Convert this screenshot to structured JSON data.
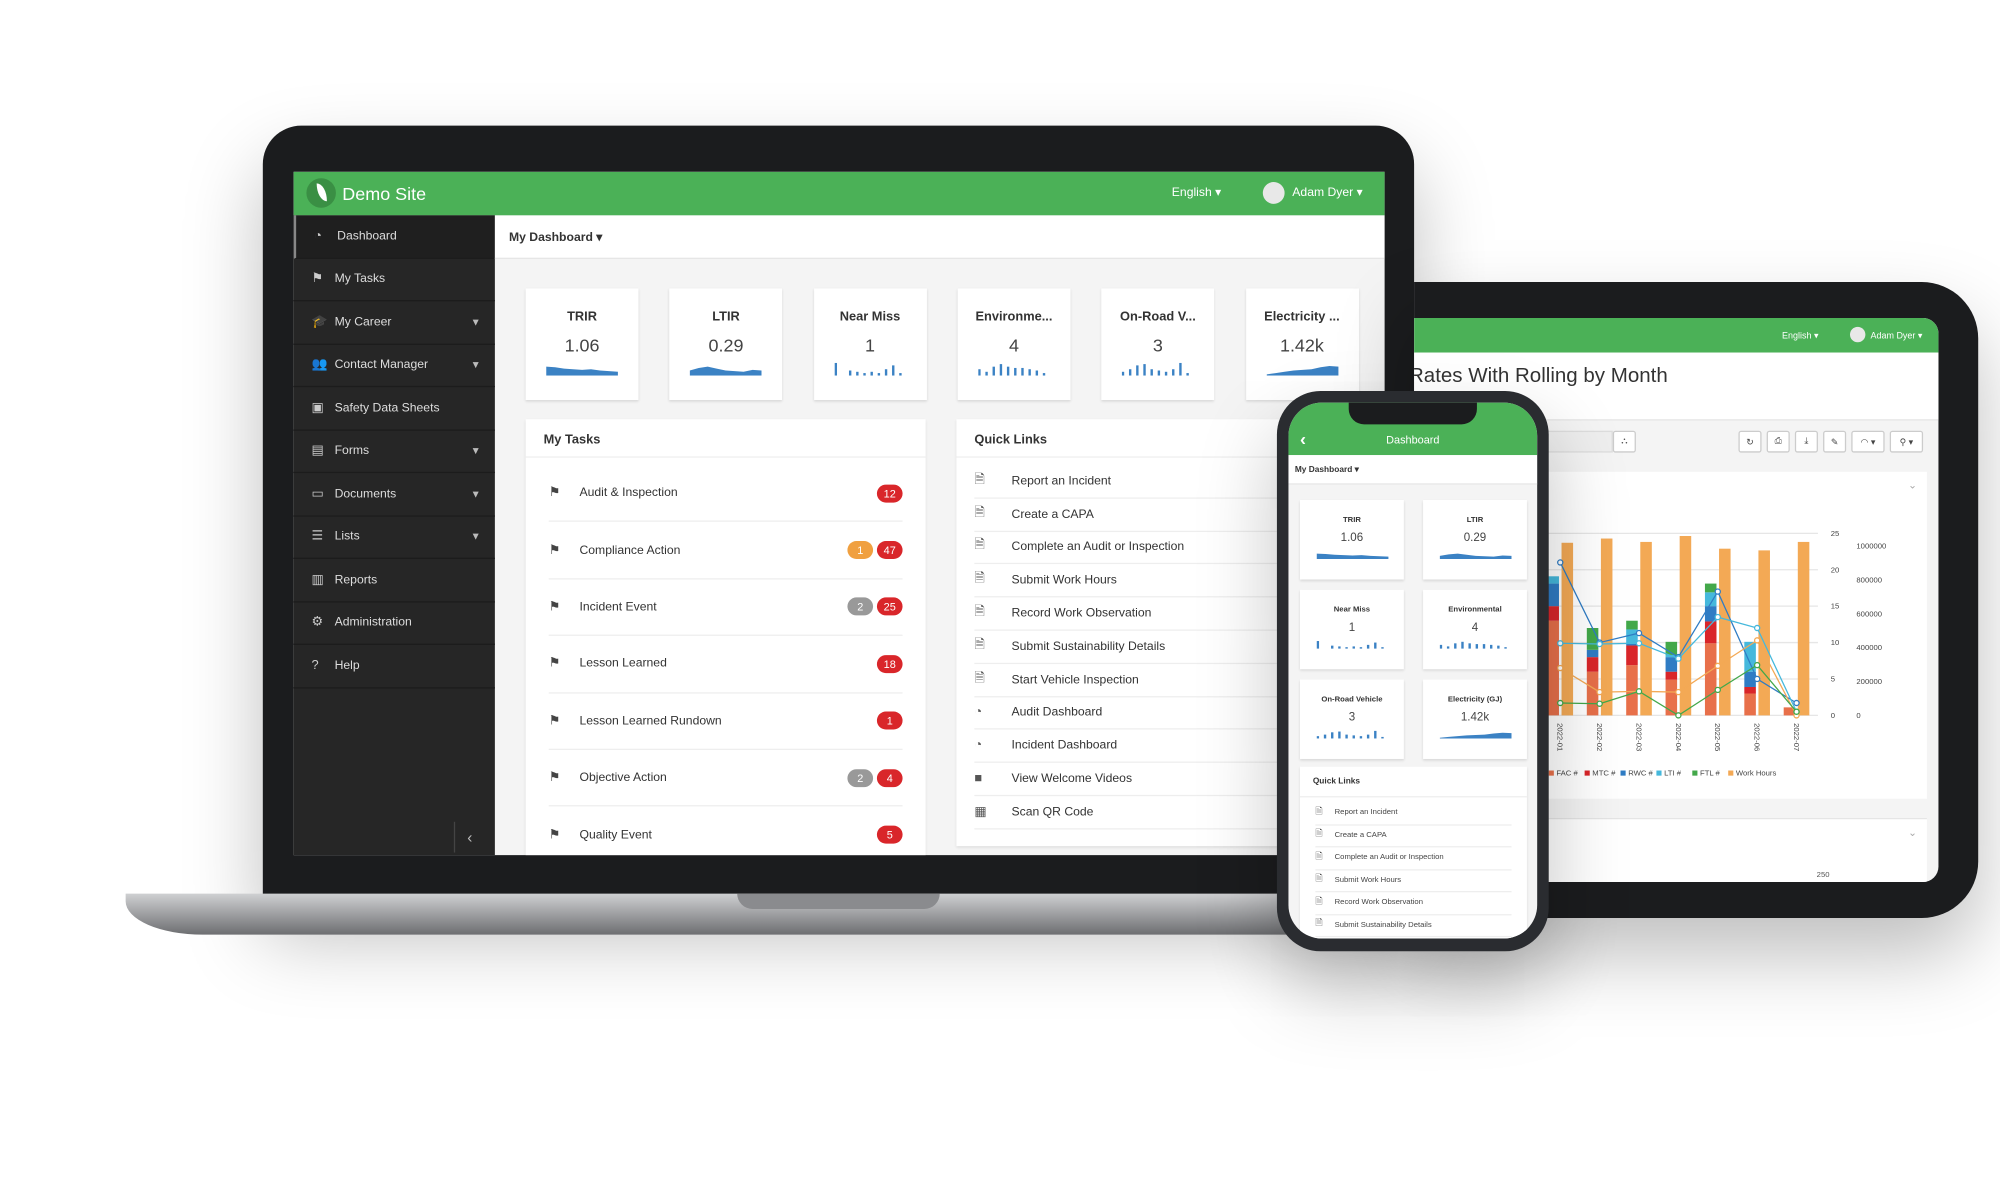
{
  "colors": {
    "brand": "#4bb157",
    "sidebar": "#262626",
    "badge_red": "#d9262a",
    "badge_orange": "#f0a040",
    "badge_gray": "#999999",
    "spark": "#3b82c4"
  },
  "laptop": {
    "site_name": "Demo Site",
    "language": "English",
    "user": "Adam Dyer",
    "dashboard_select": "My Dashboard",
    "sidebar": [
      {
        "label": "Dashboard",
        "icon": "dashboard-icon",
        "glyph": "◔",
        "sub": false
      },
      {
        "label": "My Tasks",
        "icon": "flag-icon",
        "glyph": "⚑",
        "sub": false
      },
      {
        "label": "My Career",
        "icon": "graduation-cap-icon",
        "glyph": "🎓",
        "sub": true
      },
      {
        "label": "Contact Manager",
        "icon": "users-icon",
        "glyph": "👥",
        "sub": true
      },
      {
        "label": "Safety Data Sheets",
        "icon": "briefcase-icon",
        "glyph": "▣",
        "sub": false
      },
      {
        "label": "Forms",
        "icon": "file-icon",
        "glyph": "▤",
        "sub": true
      },
      {
        "label": "Documents",
        "icon": "folder-open-icon",
        "glyph": "▭",
        "sub": true
      },
      {
        "label": "Lists",
        "icon": "list-icon",
        "glyph": "☰",
        "sub": true
      },
      {
        "label": "Reports",
        "icon": "bar-chart-icon",
        "glyph": "▥",
        "sub": false
      },
      {
        "label": "Administration",
        "icon": "gear-icon",
        "glyph": "⚙",
        "sub": false
      },
      {
        "label": "Help",
        "icon": "question-icon",
        "glyph": "?",
        "sub": false
      }
    ],
    "collapse_glyph": "‹",
    "kpis": [
      {
        "title": "TRIR",
        "value": "1.06",
        "spark": "area1"
      },
      {
        "title": "LTIR",
        "value": "0.29",
        "spark": "area2"
      },
      {
        "title": "Near Miss",
        "value": "1",
        "spark": "bars1"
      },
      {
        "title": "Environme...",
        "value": "4",
        "spark": "bars2"
      },
      {
        "title": "On-Road V...",
        "value": "3",
        "spark": "bars3"
      },
      {
        "title": "Electricity ...",
        "value": "1.42k",
        "spark": "area3"
      }
    ],
    "tasks_title": "My Tasks",
    "tasks": [
      {
        "label": "Audit & Inspection",
        "badges": [
          {
            "v": "12",
            "c": "red"
          }
        ]
      },
      {
        "label": "Compliance Action",
        "badges": [
          {
            "v": "1",
            "c": "orange"
          },
          {
            "v": "47",
            "c": "red"
          }
        ]
      },
      {
        "label": "Incident Event",
        "badges": [
          {
            "v": "2",
            "c": "gray"
          },
          {
            "v": "25",
            "c": "red"
          }
        ]
      },
      {
        "label": "Lesson Learned",
        "badges": [
          {
            "v": "18",
            "c": "red"
          }
        ]
      },
      {
        "label": "Lesson Learned Rundown",
        "badges": [
          {
            "v": "1",
            "c": "red"
          }
        ]
      },
      {
        "label": "Objective Action",
        "badges": [
          {
            "v": "2",
            "c": "gray"
          },
          {
            "v": "4",
            "c": "red"
          }
        ]
      },
      {
        "label": "Quality Event",
        "badges": [
          {
            "v": "5",
            "c": "red"
          }
        ]
      }
    ],
    "quicklinks_title": "Quick Links",
    "quicklinks": [
      {
        "label": "Report an Incident",
        "glyph": "🗎"
      },
      {
        "label": "Create a CAPA",
        "glyph": "🗎"
      },
      {
        "label": "Complete an Audit or Inspection",
        "glyph": "🗎"
      },
      {
        "label": "Submit Work Hours",
        "glyph": "🗎"
      },
      {
        "label": "Record Work Observation",
        "glyph": "🗎"
      },
      {
        "label": "Submit Sustainability Details",
        "glyph": "🗎"
      },
      {
        "label": "Start Vehicle Inspection",
        "glyph": "🗎"
      },
      {
        "label": "Audit Dashboard",
        "glyph": "◔"
      },
      {
        "label": "Incident Dashboard",
        "glyph": "◔"
      },
      {
        "label": "View Welcome Videos",
        "glyph": "■"
      },
      {
        "label": "Scan QR Code",
        "glyph": "▦"
      }
    ]
  },
  "tablet": {
    "language": "English",
    "user": "Adam Dyer",
    "report_title": "Rates With Rolling by Month",
    "toolbar": [
      "refresh-icon",
      "print-icon",
      "download-icon",
      "pencil-icon",
      "rss-icon",
      "link-icon"
    ],
    "toolbar_glyphs": [
      "↻",
      "⎙",
      "⤓",
      "✎",
      "◠ ▾",
      "⚲ ▾"
    ],
    "tree_glyph": "⛬",
    "peek_tick": "250"
  },
  "phone": {
    "title": "Dashboard",
    "back_glyph": "‹",
    "dashboard_select": "My Dashboard",
    "kpis": [
      {
        "title": "TRIR",
        "value": "1.06",
        "spark": "area1"
      },
      {
        "title": "LTIR",
        "value": "0.29",
        "spark": "area2"
      },
      {
        "title": "Near Miss",
        "value": "1",
        "spark": "bars1"
      },
      {
        "title": "Environmental",
        "value": "4",
        "spark": "bars2"
      },
      {
        "title": "On-Road Vehicle",
        "value": "3",
        "spark": "bars3"
      },
      {
        "title": "Electricity (GJ)",
        "value": "1.42k",
        "spark": "area3"
      }
    ],
    "quicklinks_title": "Quick Links",
    "quicklinks": [
      "Report an Incident",
      "Create a CAPA",
      "Complete an Audit or Inspection",
      "Submit Work Hours",
      "Record Work Observation",
      "Submit Sustainability Details"
    ]
  },
  "chart_data": {
    "type": "bar",
    "title": "Rates With Rolling by Month",
    "categories": [
      "2022-01",
      "2022-02",
      "2022-03",
      "2022-04",
      "2022-05",
      "2022-06",
      "2022-07"
    ],
    "y_left": {
      "ylim": [
        0,
        25
      ],
      "ticks": [
        "0",
        "5",
        "10",
        "15",
        "20",
        "25"
      ]
    },
    "y_right": {
      "ylim": [
        0,
        1000000
      ],
      "ticks": [
        "0",
        "200000",
        "400000",
        "600000",
        "800000",
        "1000000"
      ]
    },
    "stacked_series": [
      {
        "name": "FAC #",
        "color": "#e8704a",
        "values": [
          13,
          6,
          6.9,
          4.9,
          9.9,
          3,
          1.1
        ]
      },
      {
        "name": "MTC #",
        "color": "#d9262a",
        "values": [
          2,
          2,
          2.7,
          1.1,
          3,
          0.9,
          0
        ]
      },
      {
        "name": "RWC #",
        "color": "#2f7cc4",
        "values": [
          3.1,
          1,
          0.3,
          2,
          2.1,
          2.1,
          0
        ]
      },
      {
        "name": "LTI #",
        "color": "#45b8dc",
        "values": [
          1,
          0,
          1.9,
          0.3,
          1.9,
          4.1,
          0
        ]
      },
      {
        "name": "FTL #",
        "color": "#43a84a",
        "values": [
          0,
          3,
          1.2,
          1.8,
          1.2,
          0,
          0
        ]
      }
    ],
    "bar_series": {
      "name": "Work Hours",
      "color": "#f3a955",
      "axis": "right",
      "values": [
        1020000,
        1045000,
        1025000,
        1060000,
        985000,
        975000,
        1025000
      ]
    },
    "line_series": [
      {
        "color": "#2f7cc4",
        "values": [
          21,
          10,
          11.3,
          8,
          17,
          5,
          1.7
        ]
      },
      {
        "color": "#45b8dc",
        "values": [
          9.9,
          9.8,
          9.9,
          7.8,
          13.5,
          12,
          0.5
        ]
      },
      {
        "color": "#f3a955",
        "values": [
          6.5,
          3.2,
          3.3,
          3.2,
          6.8,
          10.3,
          0
        ]
      },
      {
        "color": "#43a84a",
        "values": [
          1.7,
          1.6,
          3.3,
          0,
          3.5,
          6.9,
          0.5
        ]
      }
    ],
    "legend": [
      "FAC #",
      "MTC #",
      "RWC #",
      "LTI #",
      "FTL #",
      "Work Hours"
    ],
    "legend_placement": "bottom",
    "grid": true
  }
}
